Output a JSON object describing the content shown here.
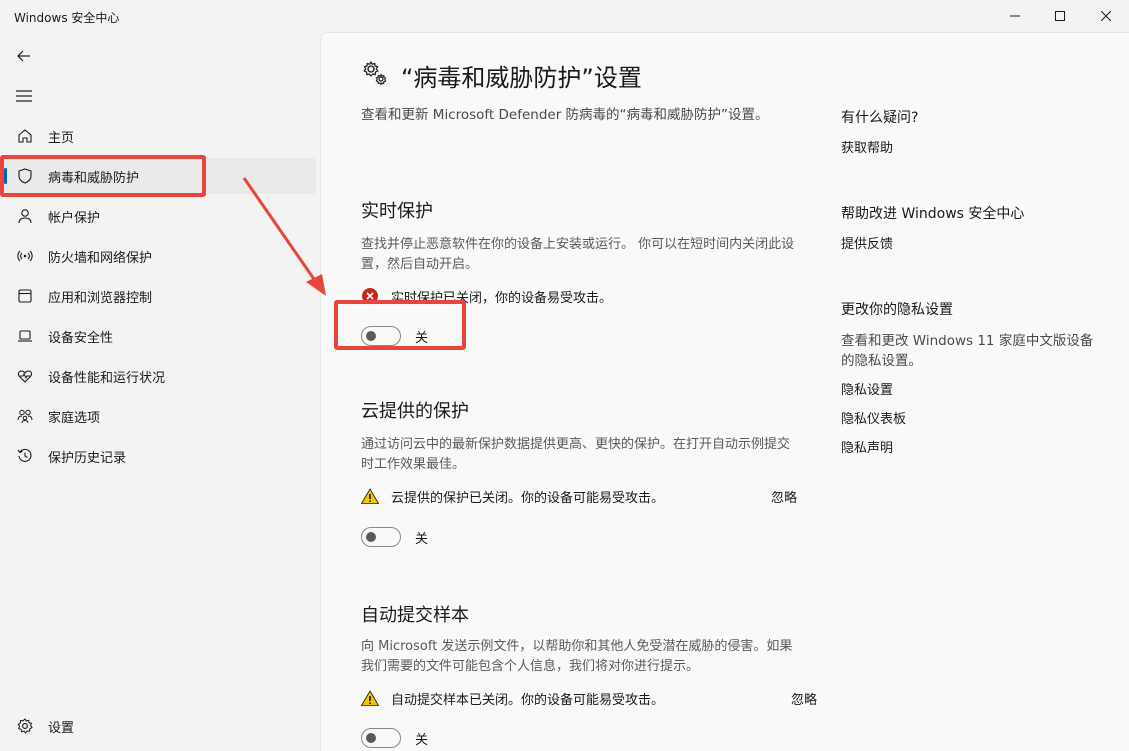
{
  "window": {
    "title": "Windows 安全中心",
    "controls": [
      "minimize",
      "maximize",
      "close"
    ]
  },
  "sidebar": {
    "items": [
      {
        "label": "主页",
        "icon": "home-icon"
      },
      {
        "label": "病毒和威胁防护",
        "icon": "shield-icon",
        "active": true
      },
      {
        "label": "帐户保护",
        "icon": "person-icon"
      },
      {
        "label": "防火墙和网络保护",
        "icon": "wifi-antenna-icon"
      },
      {
        "label": "应用和浏览器控制",
        "icon": "app-window-icon"
      },
      {
        "label": "设备安全性",
        "icon": "laptop-icon"
      },
      {
        "label": "设备性能和运行状况",
        "icon": "heart-pulse-icon"
      },
      {
        "label": "家庭选项",
        "icon": "family-icon"
      },
      {
        "label": "保护历史记录",
        "icon": "history-icon"
      }
    ],
    "settings_label": "设置"
  },
  "main": {
    "title": "“病毒和威胁防护”设置",
    "description": "查看和更新 Microsoft Defender 防病毒的“病毒和威胁防护”设置。",
    "sections": [
      {
        "title": "实时保护",
        "description": "查找并停止恶意软件在你的设备上安装或运行。 你可以在短时间内关闭此设置，然后自动开启。",
        "status_text": "实时保护已关闭，你的设备易受攻击。",
        "status_type": "error",
        "dismiss": "",
        "toggle_state": "off",
        "toggle_label": "关"
      },
      {
        "title": "云提供的保护",
        "description": "通过访问云中的最新保护数据提供更高、更快的保护。在打开自动示例提交时工作效果最佳。",
        "status_text": "云提供的保护已关闭。你的设备可能易受攻击。",
        "status_type": "warning",
        "dismiss": "忽略",
        "toggle_state": "off",
        "toggle_label": "关"
      },
      {
        "title": "自动提交样本",
        "description": "向 Microsoft 发送示例文件，以帮助你和其他人免受潜在威胁的侵害。如果我们需要的文件可能包含个人信息，我们将对你进行提示。",
        "status_text": "自动提交样本已关闭。你的设备可能易受攻击。",
        "status_type": "warning",
        "dismiss": "忽略",
        "toggle_state": "off",
        "toggle_label": "关"
      }
    ]
  },
  "aside": {
    "help_title": "有什么疑问?",
    "help_link": "获取帮助",
    "improve_title": "帮助改进 Windows 安全中心",
    "improve_link": "提供反馈",
    "privacy_title": "更改你的隐私设置",
    "privacy_text": "查看和更改 Windows 11 家庭中文版设备的隐私设置。",
    "privacy_links": [
      "隐私设置",
      "隐私仪表板",
      "隐私声明"
    ]
  },
  "colors": {
    "accent": "#005fb8",
    "error": "#c42b1c",
    "warning": "#f7c500",
    "annotation": "#e8453c"
  }
}
